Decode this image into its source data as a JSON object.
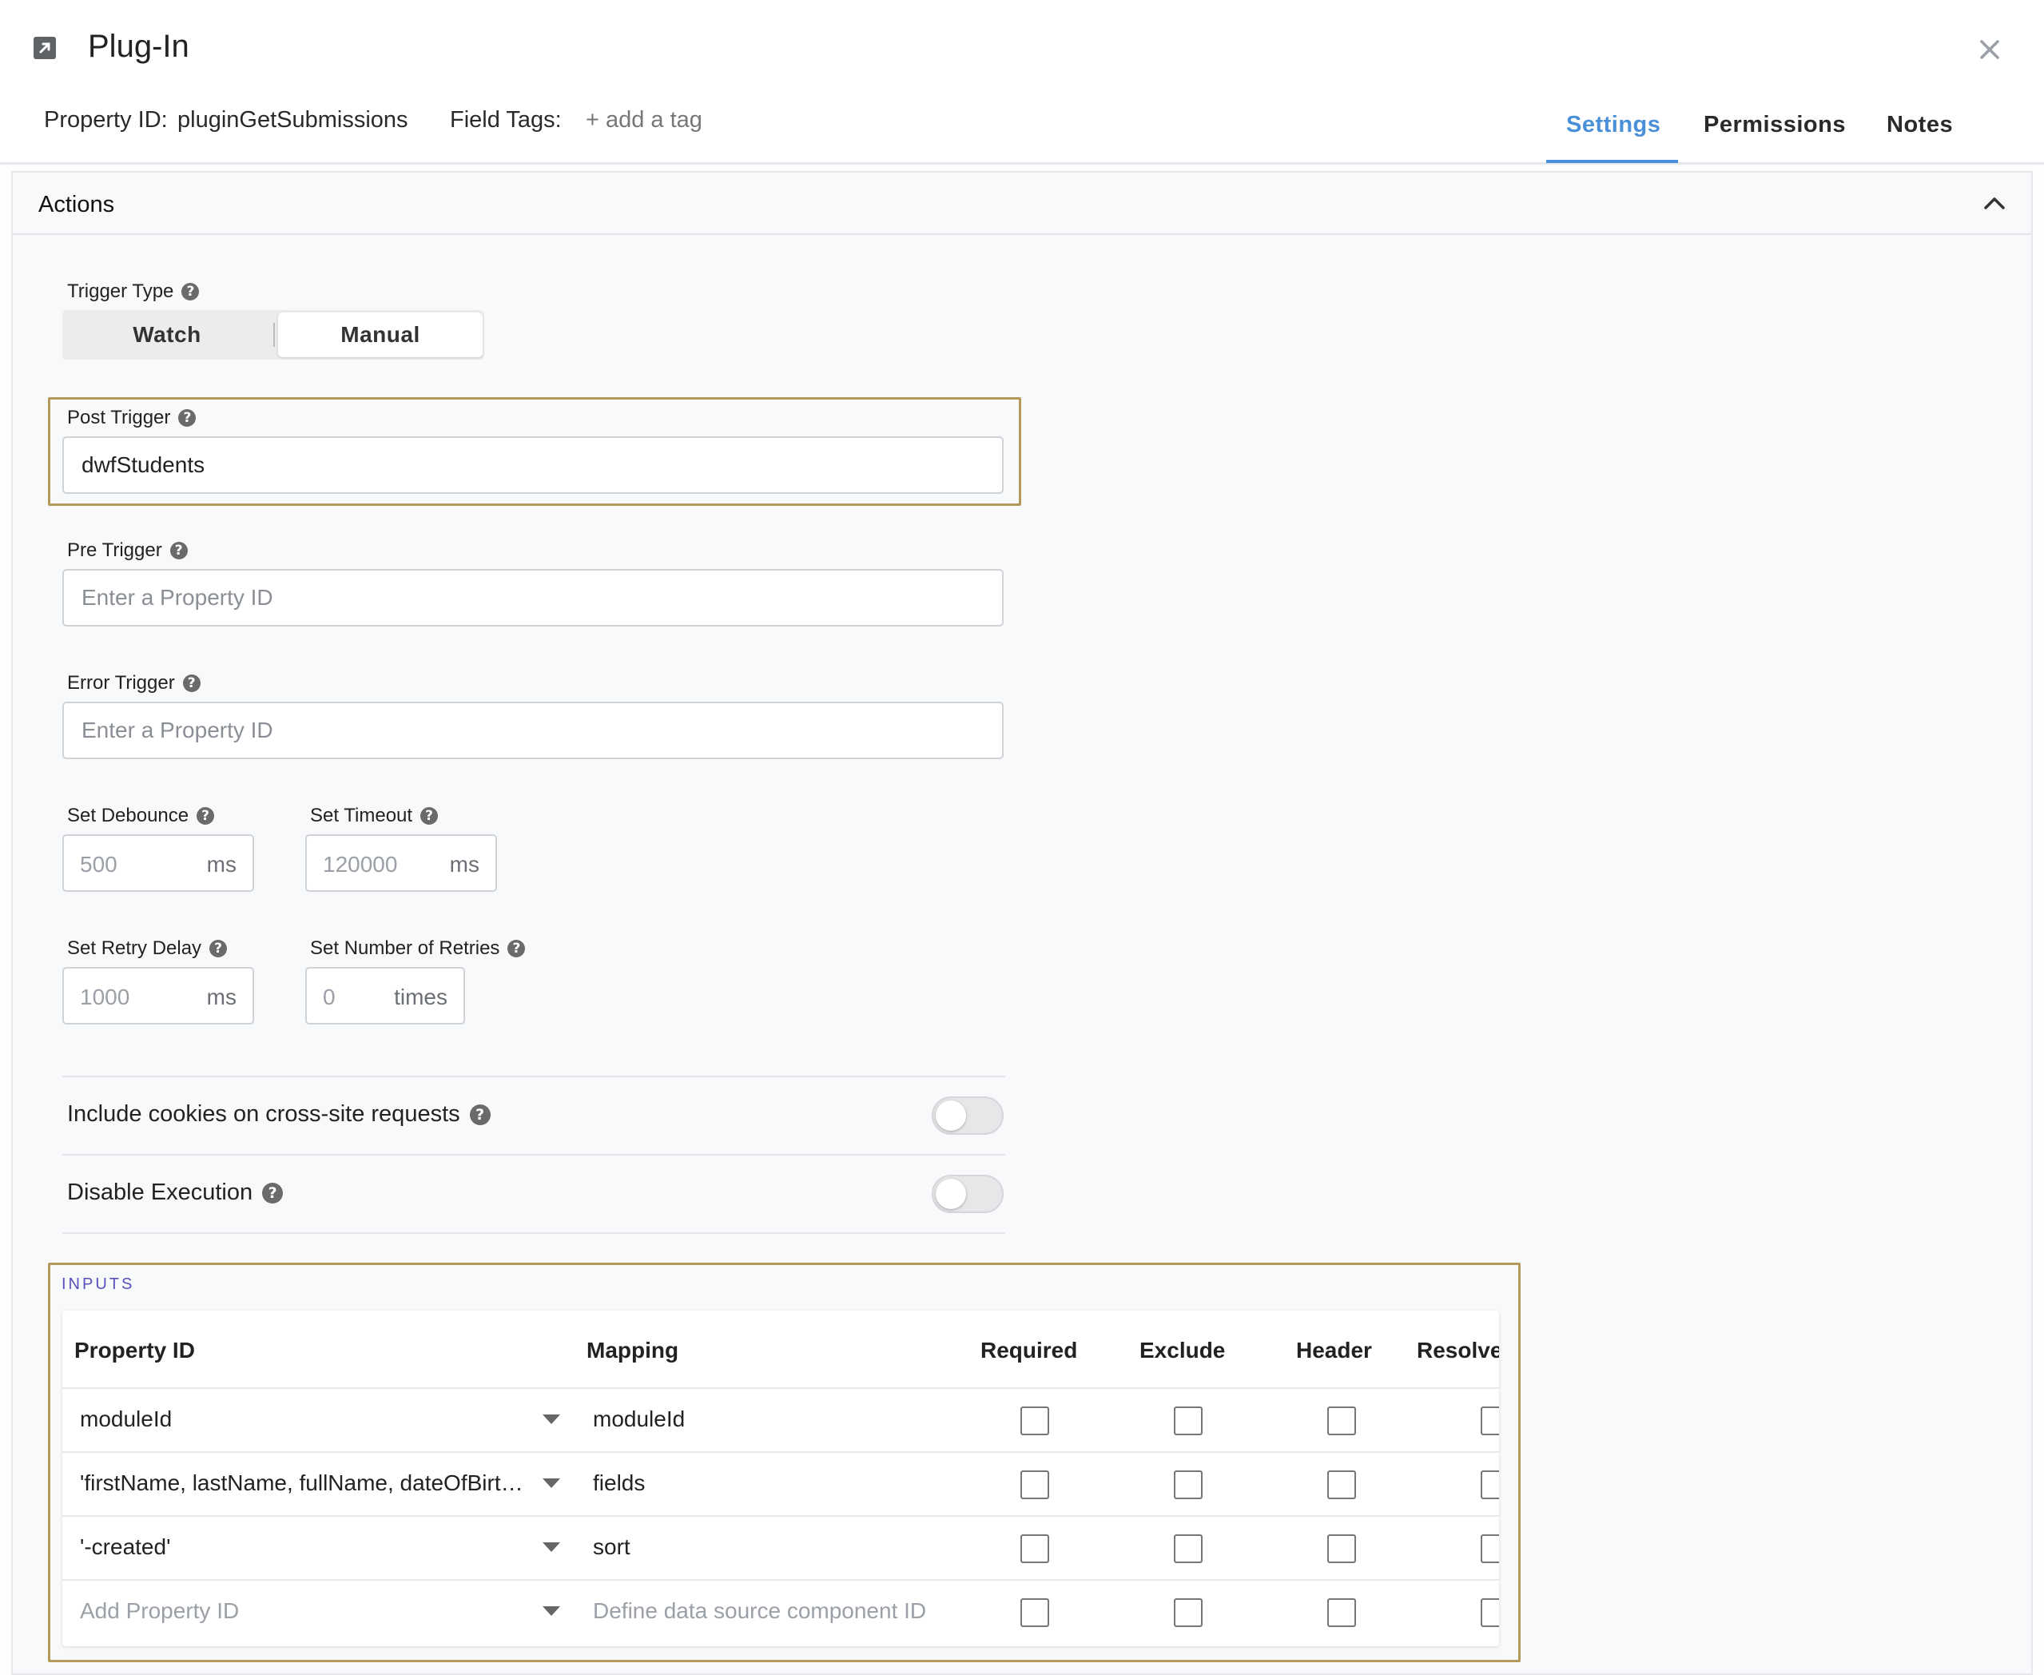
{
  "header": {
    "title": "Plug-In",
    "property_id_label": "Property ID:",
    "property_id_value": "pluginGetSubmissions",
    "field_tags_label": "Field Tags:",
    "add_tag": "+ add a tag",
    "tabs": [
      {
        "label": "Settings",
        "active": true
      },
      {
        "label": "Permissions",
        "active": false
      },
      {
        "label": "Notes",
        "active": false
      }
    ]
  },
  "actions": {
    "title": "Actions",
    "trigger_type_label": "Trigger Type",
    "trigger_options": [
      "Watch",
      "Manual"
    ],
    "trigger_selected": "Manual",
    "post_trigger_label": "Post Trigger",
    "post_trigger_value": "dwfStudents",
    "pre_trigger_label": "Pre Trigger",
    "pre_trigger_placeholder": "Enter a Property ID",
    "error_trigger_label": "Error Trigger",
    "error_trigger_placeholder": "Enter a Property ID",
    "debounce_label": "Set Debounce",
    "debounce_placeholder": "500",
    "debounce_unit": "ms",
    "timeout_label": "Set Timeout",
    "timeout_placeholder": "120000",
    "timeout_unit": "ms",
    "retry_delay_label": "Set Retry Delay",
    "retry_delay_placeholder": "1000",
    "retry_delay_unit": "ms",
    "retries_label": "Set Number of Retries",
    "retries_placeholder": "0",
    "retries_unit": "times",
    "cookies_label": "Include cookies on cross-site requests",
    "cookies_on": false,
    "disable_label": "Disable Execution",
    "disable_on": false
  },
  "inputs": {
    "title": "INPUTS",
    "columns": [
      "Property ID",
      "Mapping",
      "Required",
      "Exclude",
      "Header",
      "Resolve"
    ],
    "rows": [
      {
        "property_id": "moduleId",
        "mapping": "moduleId"
      },
      {
        "property_id": "'firstName, lastName, fullName, dateOfBirt…",
        "mapping": "fields"
      },
      {
        "property_id": "'-created'",
        "mapping": "sort"
      }
    ],
    "new_row": {
      "property_placeholder": "Add Property ID",
      "mapping_placeholder": "Define data source component ID"
    }
  },
  "colors": {
    "accent": "#4a90d9",
    "highlight_border": "#b49a5a",
    "inputs_title": "#5a4fbf"
  }
}
